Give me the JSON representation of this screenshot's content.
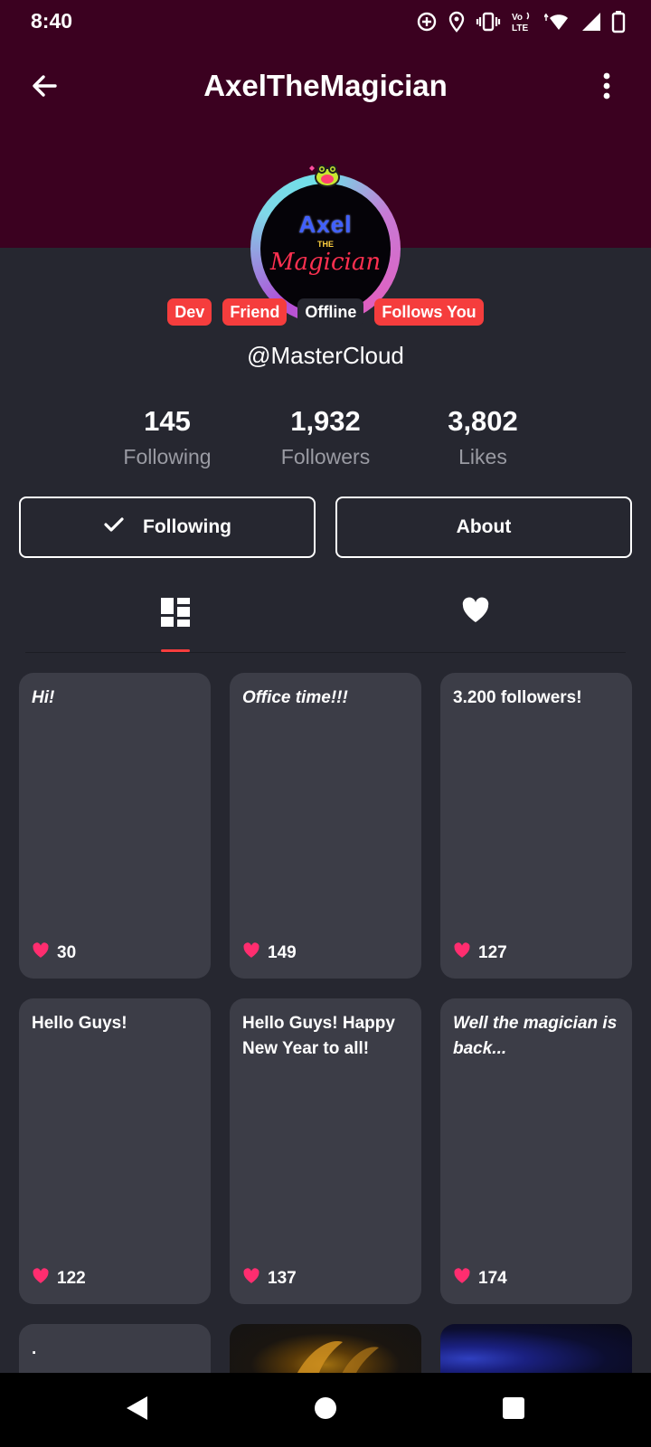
{
  "status_bar": {
    "time": "8:40",
    "icons": [
      "data-saver-icon",
      "location-icon",
      "vibrate-icon",
      "volte-icon",
      "wifi-icon",
      "signal-icon",
      "battery-icon"
    ],
    "volte_label": "Vo LTE"
  },
  "app_bar": {
    "title": "AxelTheMagician",
    "back_icon": "arrow-left-icon",
    "more_icon": "more-vertical-icon"
  },
  "profile": {
    "avatar_logo": {
      "line1": "Axel",
      "line2": "THE",
      "line3": "Magician"
    },
    "badges": [
      {
        "label": "Dev",
        "style": "red"
      },
      {
        "label": "Friend",
        "style": "red"
      },
      {
        "label": "Offline",
        "style": "dark"
      },
      {
        "label": "Follows You",
        "style": "red"
      }
    ],
    "username": "@MasterCloud"
  },
  "stats": [
    {
      "value": "145",
      "label": "Following"
    },
    {
      "value": "1,932",
      "label": "Followers"
    },
    {
      "value": "3,802",
      "label": "Likes"
    }
  ],
  "actions": {
    "following_label": "Following",
    "about_label": "About"
  },
  "tabs": [
    {
      "icon": "grid-icon",
      "selected": true
    },
    {
      "icon": "heart-icon",
      "selected": false
    }
  ],
  "posts": [
    {
      "text": "Hi!",
      "likes": "30",
      "italic": true
    },
    {
      "text": "Office time!!!",
      "likes": "149",
      "italic": true
    },
    {
      "text": "3.200 followers!",
      "likes": "127",
      "italic": false
    },
    {
      "text": "Hello Guys!",
      "likes": "122",
      "italic": false
    },
    {
      "text": "Hello Guys! Happy New Year to all!",
      "likes": "137",
      "italic": false
    },
    {
      "text": "Well the magician is back...",
      "likes": "174",
      "italic": true
    },
    {
      "text": ".",
      "likes": "",
      "italic": false
    }
  ],
  "colors": {
    "header_bg": "#3b0120",
    "page_bg": "#262730",
    "card_bg": "#3c3d47",
    "accent_red": "#f53d3d",
    "heart_pink": "#ff2d6f"
  },
  "nav_bar": {
    "back_icon": "triangle-back-icon",
    "home_icon": "circle-home-icon",
    "recents_icon": "square-recents-icon"
  }
}
